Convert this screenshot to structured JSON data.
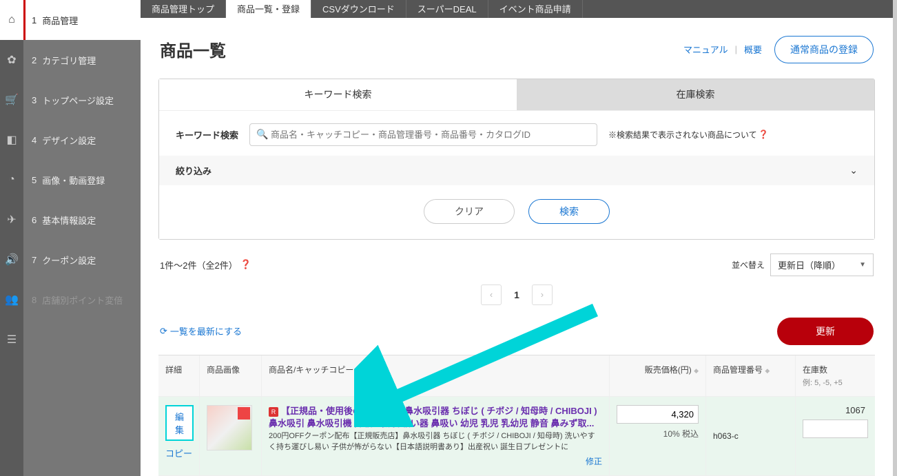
{
  "sidebar": {
    "items": [
      {
        "num": "1",
        "label": "商品管理",
        "active": true
      },
      {
        "num": "2",
        "label": "カテゴリ管理"
      },
      {
        "num": "3",
        "label": "トップページ設定"
      },
      {
        "num": "4",
        "label": "デザイン設定"
      },
      {
        "num": "5",
        "label": "画像・動画登録"
      },
      {
        "num": "6",
        "label": "基本情報設定"
      },
      {
        "num": "7",
        "label": "クーポン設定"
      },
      {
        "num": "8",
        "label": "店舗別ポイント変倍",
        "disabled": true
      }
    ]
  },
  "topbar": {
    "tabs": [
      "商品管理トップ",
      "商品一覧・登録",
      "CSVダウンロード",
      "スーパーDEAL",
      "イベント商品申請"
    ],
    "active_index": 1
  },
  "page": {
    "title": "商品一覧",
    "manual": "マニュアル",
    "summary": "概要",
    "register_btn": "通常商品の登録"
  },
  "search": {
    "tabs": {
      "keyword": "キーワード検索",
      "stock": "在庫検索"
    },
    "keyword_label": "キーワード検索",
    "placeholder": "商品名・キャッチコピー・商品管理番号・商品番号・カタログID",
    "notice": "※検索結果で表示されない商品について",
    "filter_label": "絞り込み",
    "clear_btn": "クリア",
    "search_btn": "検索"
  },
  "list": {
    "count_text": "1件～2件（全2件）",
    "sort_label": "並べ替え",
    "sort_value": "更新日（降順）",
    "page_num": "1",
    "refresh": "一覧を最新にする",
    "update_btn": "更新"
  },
  "table": {
    "headers": {
      "detail": "詳細",
      "img": "商品画像",
      "name": "商品名/キャッチコピー",
      "price": "販売価格(円)",
      "mng": "商品管理番号",
      "stock": "在庫数",
      "stock_sub": "例: 5, -5, +5"
    },
    "row": {
      "edit": "編集",
      "copy": "コピー",
      "name1": "【正規品・使用後の返品OK】 鼻水吸引器 ちぼじ ( チボジ / 知母時 / CHIBOJI )",
      "name2": "鼻水吸引 鼻水吸引機 鼻吸い機 鼻吸い器 鼻吸い 幼児 乳児 乳幼児 静音 鼻みず取...",
      "desc": "200円OFFクーポン配布【正規販売店】鼻水吸引器 ちぼじ ( チボジ / CHIBOJI / 知母時) 洗いやすく持ち運びし易い 子供が怖がらない【日本語説明書あり】出産祝い 誕生日プレゼントに",
      "fix": "修正",
      "price": "4,320",
      "tax": "10% 税込",
      "mng": "h063-c",
      "stock": "1067"
    }
  }
}
